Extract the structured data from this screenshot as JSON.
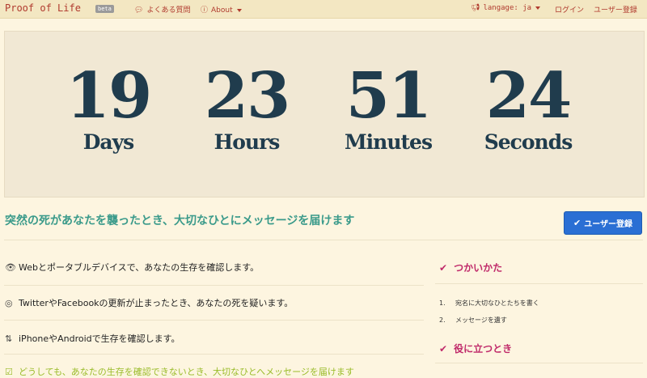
{
  "nav": {
    "brand": "Proof of Life",
    "beta": "beta",
    "faq": "よくある質問",
    "about": "About",
    "language": "langage: ja",
    "login": "ログイン",
    "signup": "ユーザー登録"
  },
  "countdown": [
    {
      "value": "19",
      "label": "Days"
    },
    {
      "value": "23",
      "label": "Hours"
    },
    {
      "value": "51",
      "label": "Minutes"
    },
    {
      "value": "24",
      "label": "Seconds"
    }
  ],
  "lead": "突然の死があなたを襲ったとき、大切なひとにメッセージを届けます",
  "signup_button": "ユーザー登録",
  "features": [
    {
      "icon": "eye-icon",
      "text": "Webとポータブルデバイスで、あなたの生存を確認します。"
    },
    {
      "icon": "eye-slash-icon",
      "text": "TwitterやFacebookの更新が止まったとき、あなたの死を疑います。"
    },
    {
      "icon": "retweet-icon",
      "text": "iPhoneやAndroidで生存を確認します。"
    },
    {
      "icon": "check-icon",
      "text": "どうしても、あなたの生存を確認できないとき、大切なひとへメッセージを届けます"
    }
  ],
  "sidebar": {
    "howto_title": "つかいかた",
    "steps": [
      {
        "n": "1.",
        "text": "宛名に大切なひとたちを書く"
      },
      {
        "n": "2.",
        "text": "メッセージを遺す"
      }
    ],
    "useful_title": "役に立つとき"
  },
  "colors": {
    "nav_text": "#b03a2e",
    "countdown_text": "#203c4d",
    "lead": "#3a9a8a",
    "button": "#2a6fd4",
    "sidebar_title": "#c02a6a"
  }
}
